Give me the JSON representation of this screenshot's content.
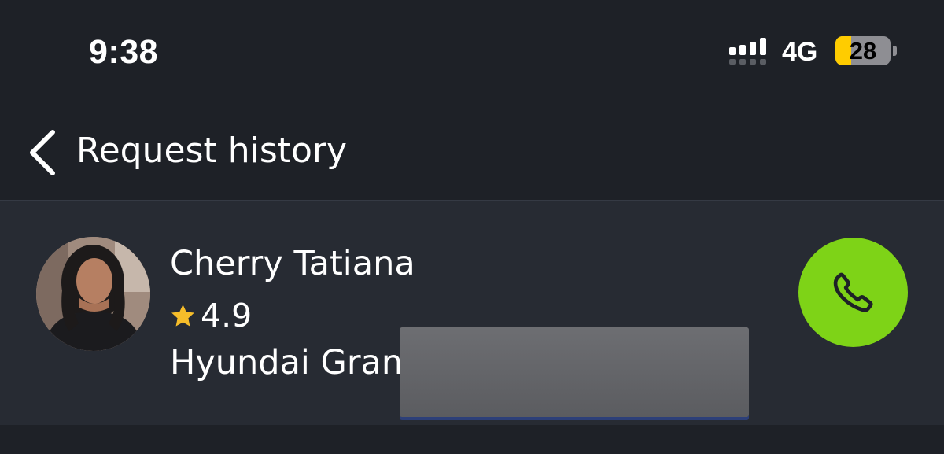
{
  "status_bar": {
    "time": "9:38",
    "network": "4G",
    "battery_level": "28",
    "battery_fraction": 0.28,
    "signal_icon": "cellular-signal-icon"
  },
  "nav": {
    "back_icon": "chevron-left-icon",
    "title": "Request history"
  },
  "driver": {
    "name": "Cherry Tatiana",
    "rating": "4.9",
    "rating_icon": "star-icon",
    "vehicle": "Hyundai Gran",
    "call_icon": "phone-icon"
  },
  "colors": {
    "background": "#1e2127",
    "card": "#272b33",
    "call_button": "#7ed317",
    "star": "#f6bd2a",
    "battery_fill": "#ffcc00"
  }
}
